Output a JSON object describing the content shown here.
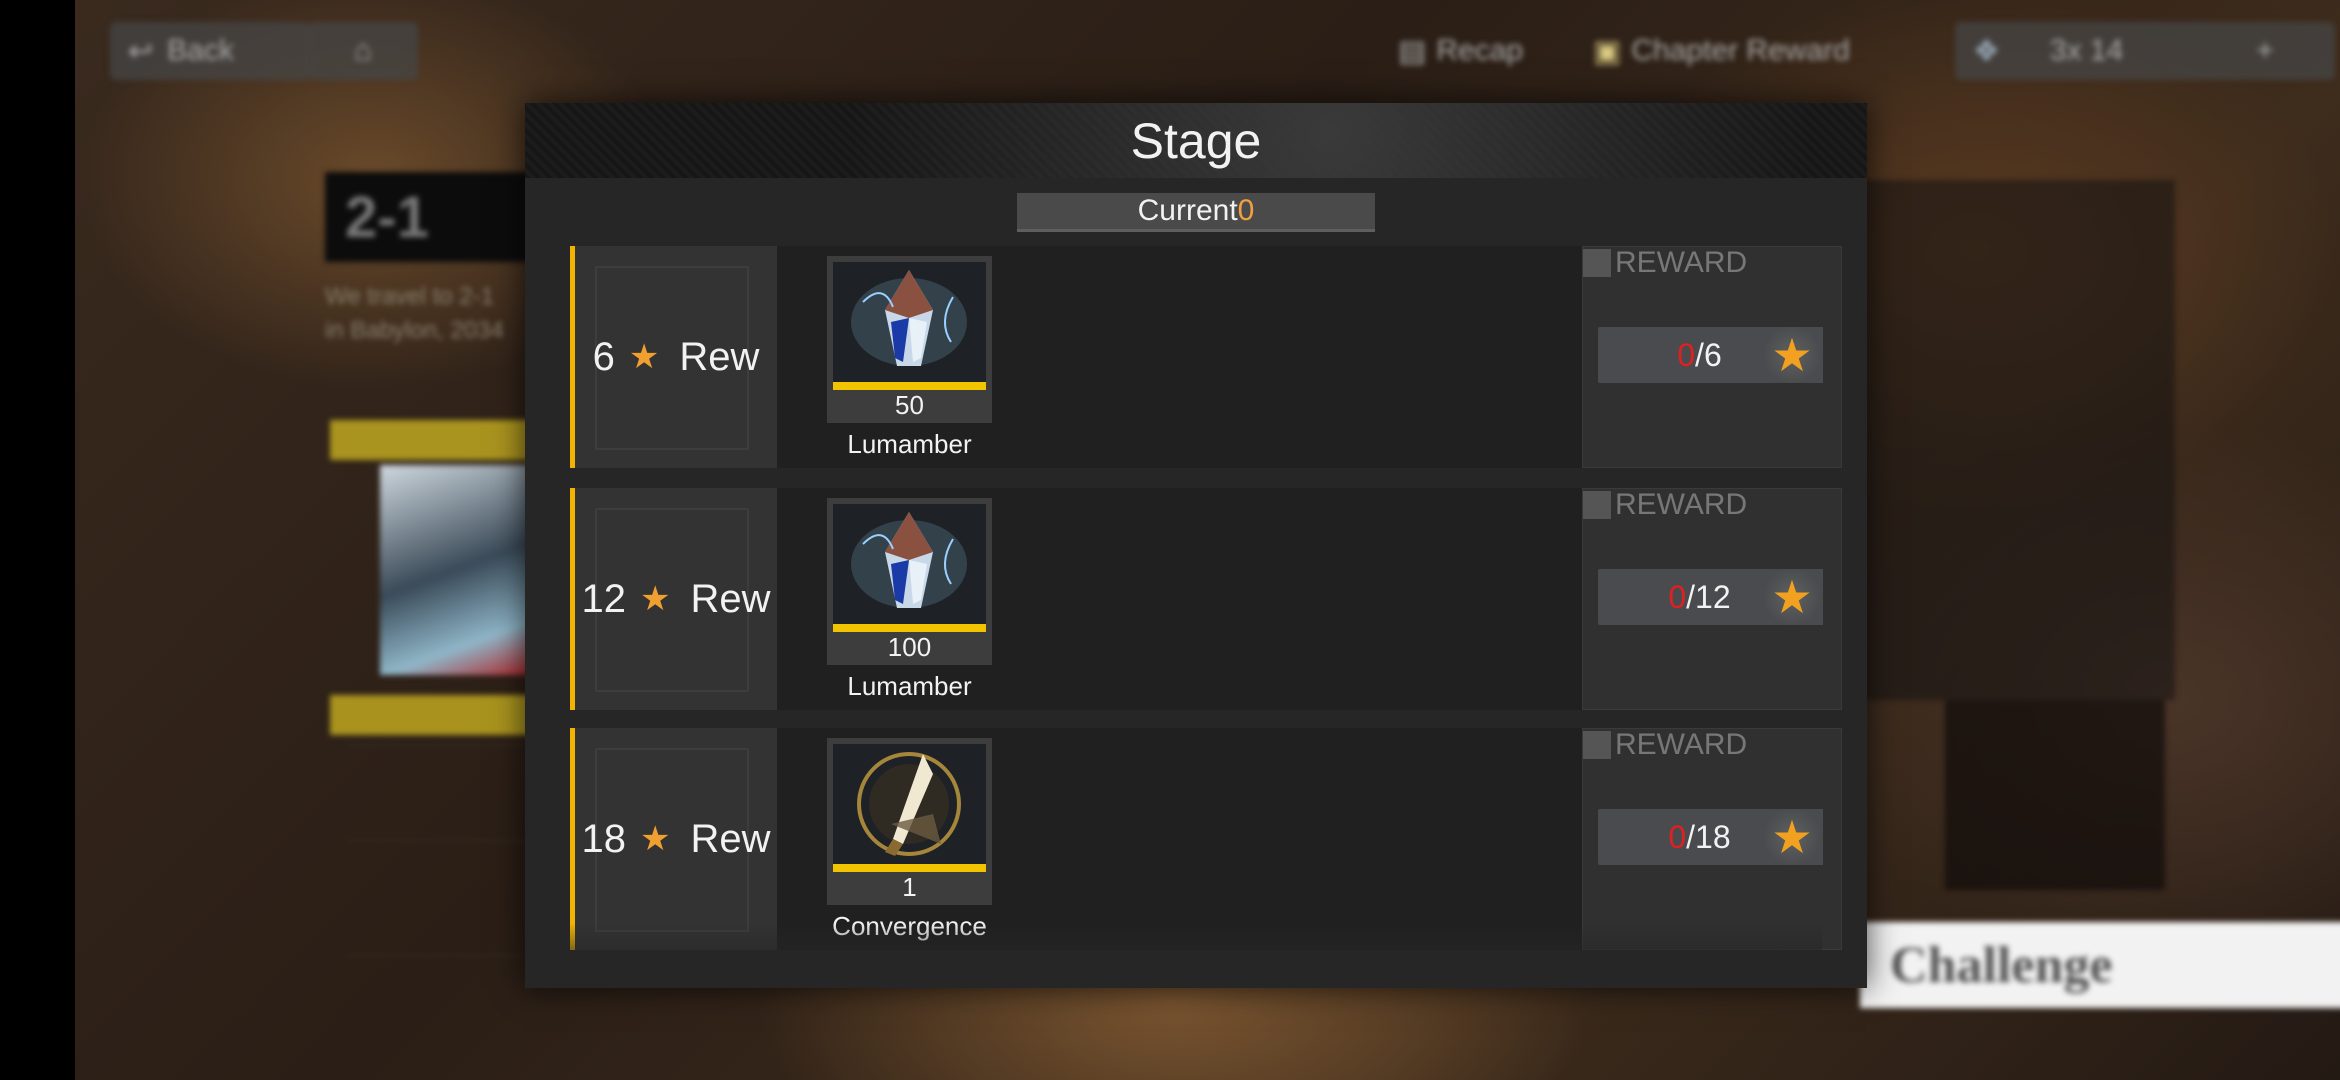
{
  "background": {
    "back_label": "Back",
    "stage_tag": "2-1",
    "description_lines": [
      "We travel to 2-1",
      "in Babylon, 2034"
    ],
    "top_right_left_label": "Recap",
    "chapter_reward_label": "Chapter Reward",
    "resource_counter": "3x 14",
    "challenge_label": "Challenge"
  },
  "modal": {
    "title": "Stage",
    "current_label": "Current",
    "current_value": "0",
    "rows": [
      {
        "threshold": "6",
        "rew_label": "Rew",
        "item_count": "50",
        "item_name": "Lumamber",
        "item_icon": "lumamber-crystal-icon",
        "reward_label": "REWARD",
        "progress_current": "0",
        "progress_total": "/6"
      },
      {
        "threshold": "12",
        "rew_label": "Rew",
        "item_count": "100",
        "item_name": "Lumamber",
        "item_icon": "lumamber-crystal-icon",
        "reward_label": "REWARD",
        "progress_current": "0",
        "progress_total": "/12"
      },
      {
        "threshold": "18",
        "rew_label": "Rew",
        "item_count": "1",
        "item_name": "Convergence",
        "item_icon": "convergence-blade-icon",
        "reward_label": "REWARD",
        "progress_current": "0",
        "progress_total": "/18"
      }
    ]
  },
  "colors": {
    "accent_gold": "#f2b400",
    "star_orange": "#f0a030",
    "progress_red": "#e02020",
    "current_value_orange": "#f0a040"
  }
}
